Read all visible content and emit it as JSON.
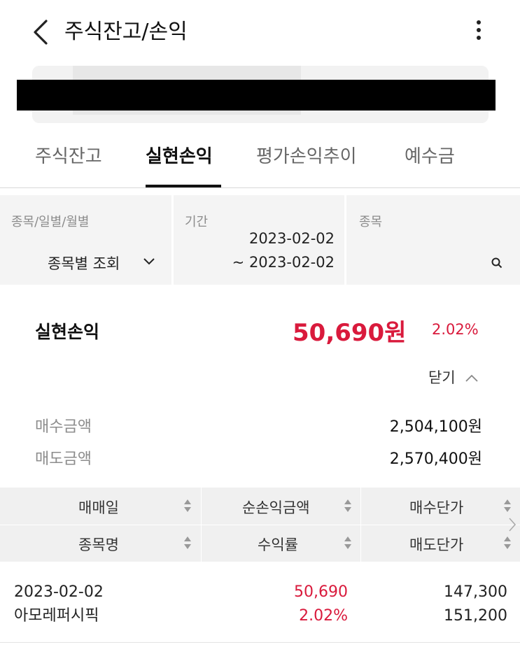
{
  "header": {
    "title": "주식잔고/손익"
  },
  "tabs": [
    {
      "label": "주식잔고"
    },
    {
      "label": "실현손익"
    },
    {
      "label": "평가손익추이"
    },
    {
      "label": "예수금"
    }
  ],
  "filters": {
    "view_label": "종목/일별/월별",
    "view_value": "종목별 조회",
    "period_label": "기간",
    "period_start": "2023-02-02",
    "period_end": "~ 2023-02-02",
    "stock_label": "종목"
  },
  "summary": {
    "label": "실현손익",
    "amount": "50,690원",
    "rate": "2.02%",
    "toggle_label": "닫기",
    "buy_label": "매수금액",
    "buy_value": "2,504,100원",
    "sell_label": "매도금액",
    "sell_value": "2,570,400원"
  },
  "table": {
    "headers_row1": [
      "매매일",
      "순손익금액",
      "매수단가"
    ],
    "headers_row2": [
      "종목명",
      "수익률",
      "매도단가"
    ],
    "rows": [
      {
        "date": "2023-02-02",
        "name": "아모레퍼시픽",
        "net_profit": "50,690",
        "rate": "2.02%",
        "buy_price": "147,300",
        "sell_price": "151,200"
      }
    ]
  },
  "colors": {
    "accent_red": "#d91a3c",
    "filter_bg": "#f4f4f4",
    "table_header_bg": "#f0f0f0"
  },
  "icons": [
    "back-arrow-icon",
    "more-vertical-icon",
    "chevron-down-icon",
    "search-icon",
    "chevron-up-icon",
    "sort-icon",
    "chevron-right-icon"
  ]
}
